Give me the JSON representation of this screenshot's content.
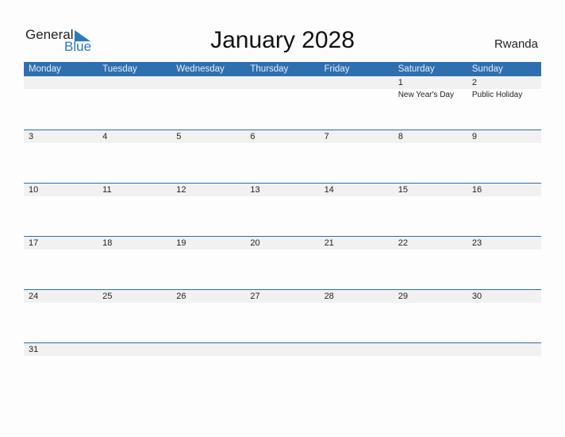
{
  "logo": {
    "line1": "General",
    "line2": "Blue"
  },
  "title": "January 2028",
  "country": "Rwanda",
  "weekdays": [
    "Monday",
    "Tuesday",
    "Wednesday",
    "Thursday",
    "Friday",
    "Saturday",
    "Sunday"
  ],
  "weeks": [
    [
      {
        "day": ""
      },
      {
        "day": ""
      },
      {
        "day": ""
      },
      {
        "day": ""
      },
      {
        "day": ""
      },
      {
        "day": "1",
        "event": "New Year's Day"
      },
      {
        "day": "2",
        "event": "Public Holiday"
      }
    ],
    [
      {
        "day": "3"
      },
      {
        "day": "4"
      },
      {
        "day": "5"
      },
      {
        "day": "6"
      },
      {
        "day": "7"
      },
      {
        "day": "8"
      },
      {
        "day": "9"
      }
    ],
    [
      {
        "day": "10"
      },
      {
        "day": "11"
      },
      {
        "day": "12"
      },
      {
        "day": "13"
      },
      {
        "day": "14"
      },
      {
        "day": "15"
      },
      {
        "day": "16"
      }
    ],
    [
      {
        "day": "17"
      },
      {
        "day": "18"
      },
      {
        "day": "19"
      },
      {
        "day": "20"
      },
      {
        "day": "21"
      },
      {
        "day": "22"
      },
      {
        "day": "23"
      }
    ],
    [
      {
        "day": "24"
      },
      {
        "day": "25"
      },
      {
        "day": "26"
      },
      {
        "day": "27"
      },
      {
        "day": "28"
      },
      {
        "day": "29"
      },
      {
        "day": "30"
      }
    ],
    [
      {
        "day": "31"
      },
      {
        "day": ""
      },
      {
        "day": ""
      },
      {
        "day": ""
      },
      {
        "day": ""
      },
      {
        "day": ""
      },
      {
        "day": ""
      }
    ]
  ],
  "colors": {
    "accent": "#2e6fb0",
    "band": "#f1f1f1",
    "logo_blue": "#2a7ac0"
  }
}
